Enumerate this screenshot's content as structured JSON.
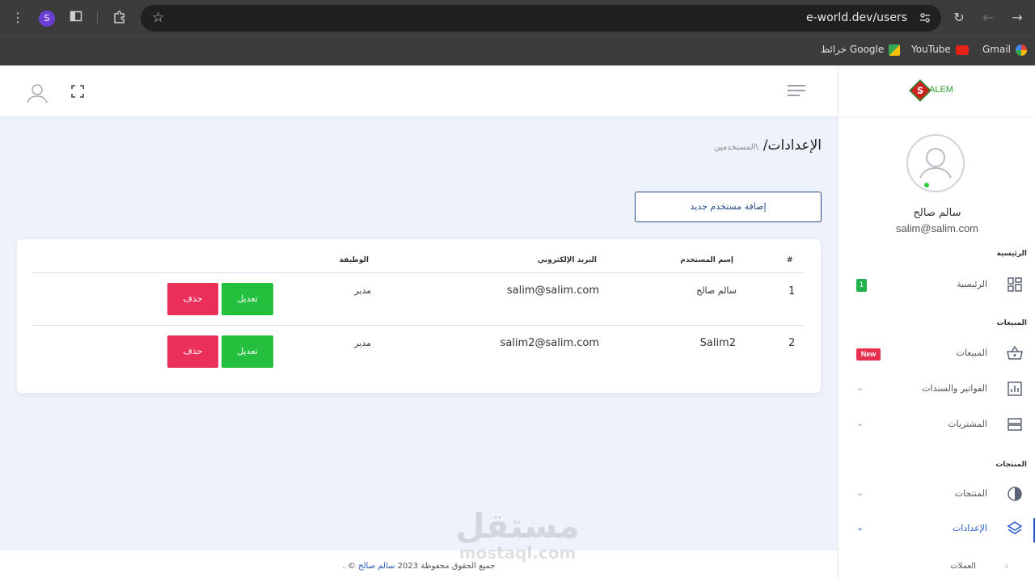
{
  "browser": {
    "url": "e-world.dev/users",
    "profile_initial": "S",
    "bookmarks": [
      {
        "label": "Gmail"
      },
      {
        "label": "YouTube"
      },
      {
        "label": "خرائط Google"
      }
    ]
  },
  "sidebar": {
    "logo_text": "ALEM",
    "logo_letter": "S",
    "user_name": "سالم صالح",
    "user_email": "salim@salim.com",
    "sections": [
      {
        "title": "الرئيسية"
      },
      {
        "title": "المبيعات"
      },
      {
        "title": "المنتجات"
      }
    ],
    "items": [
      {
        "label": "الرئيسية",
        "badge": "1",
        "icon": "dashboard-icon"
      },
      {
        "label": "المبيعات",
        "badge": "New",
        "icon": "basket-icon"
      },
      {
        "label": "الفواتير والسندات",
        "icon": "chart-icon"
      },
      {
        "label": "المشتريات",
        "icon": "server-icon"
      },
      {
        "label": "المنتجات",
        "icon": "contrast-icon"
      },
      {
        "label": "الإعدادات",
        "icon": "layers-icon"
      },
      {
        "label": "العملات"
      }
    ]
  },
  "page": {
    "breadcrumb_main": "الإعدادات/",
    "breadcrumb_sub": "\\المستخدمين",
    "add_button": "إضافة مستخدم جديد"
  },
  "table": {
    "headers": [
      "#",
      "إسم المستخدم",
      "البريد الإلكتروني",
      "الوظيفة"
    ],
    "rows": [
      {
        "num": "1",
        "name": "سالم صالح",
        "email": "salim@salim.com",
        "role": "مدير"
      },
      {
        "num": "2",
        "name": "Salim2",
        "email": "salim2@salim.com",
        "role": "مدير"
      }
    ],
    "edit_label": "تعديل",
    "delete_label": "حذف"
  },
  "footer": {
    "text": "جميع الحقوق محفوظة 2023",
    "link": "سالم صالح",
    "suffix": "© ."
  },
  "watermark": {
    "main": "مستقل",
    "sub": "mostaql.com"
  },
  "colors": {
    "accent": "#2a4c8a",
    "edit": "#22c03c",
    "delete": "#eb2f5b",
    "active": "#2255cc"
  }
}
